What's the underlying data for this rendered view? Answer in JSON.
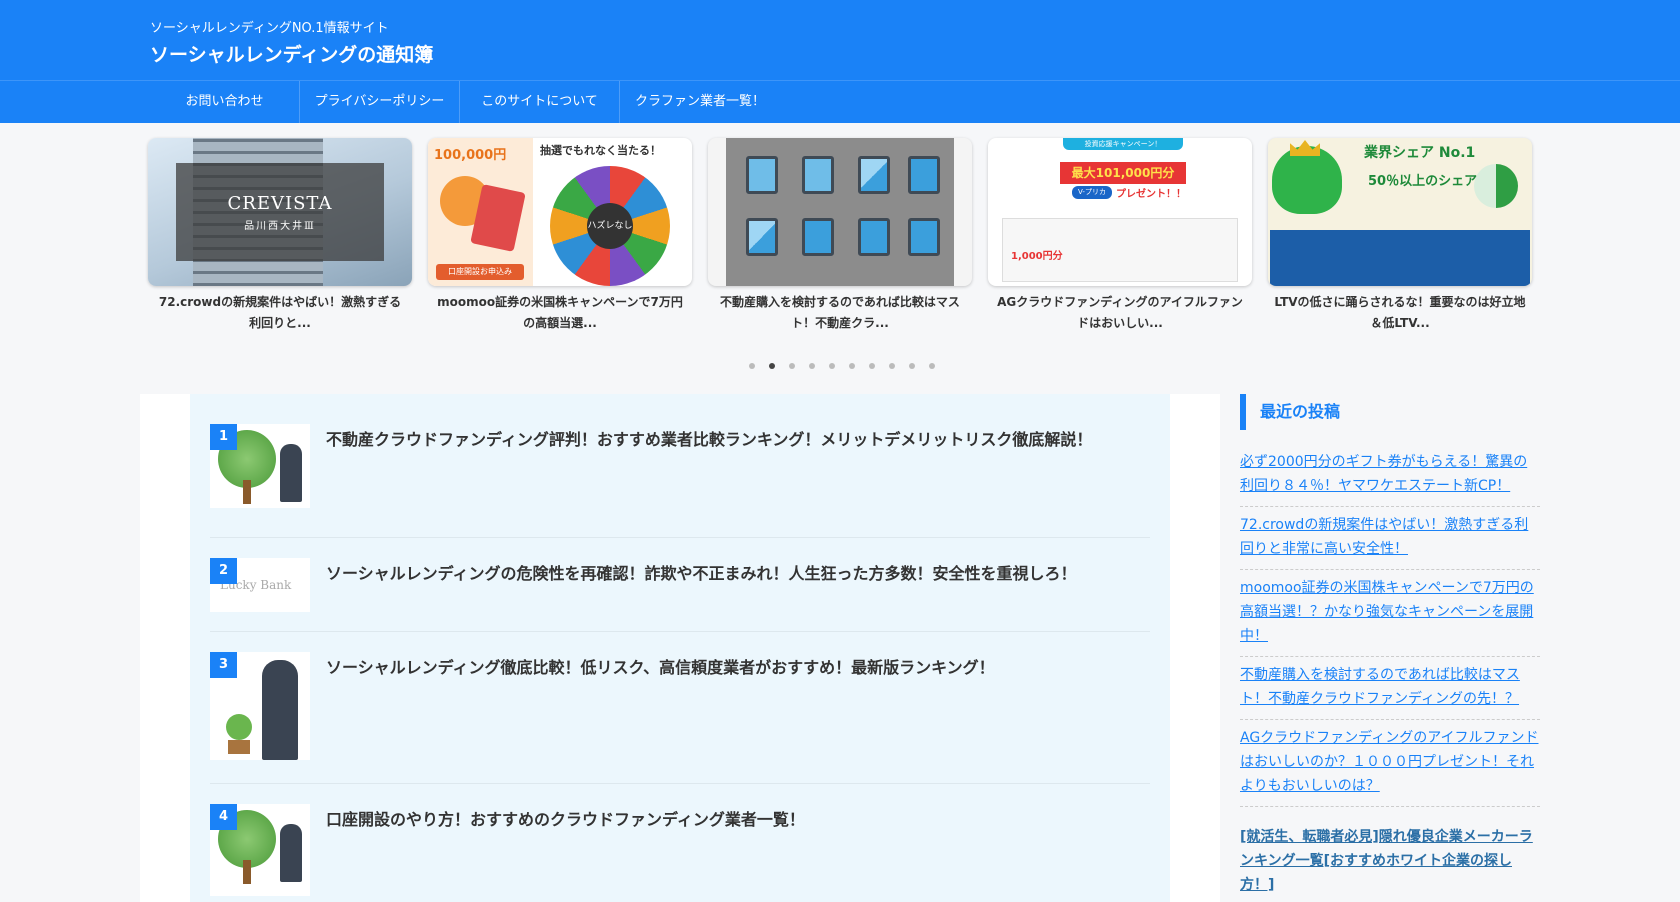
{
  "header": {
    "tagline": "ソーシャルレンディングNO.1情報サイト",
    "title": "ソーシャルレンディングの通知簿"
  },
  "nav": {
    "items": [
      {
        "label": "お問い合わせ"
      },
      {
        "label": "プライバシーポリシー"
      },
      {
        "label": "このサイトについて"
      },
      {
        "label": "クラファン業者一覧！"
      }
    ]
  },
  "carousel": {
    "cards": [
      {
        "title": "72.crowdの新規案件はやばい！激熱すぎる利回りと...",
        "logo": "CREVISTA",
        "logo_sub": "品川西大井Ⅲ"
      },
      {
        "title": "moomoo証券の米国株キャンペーンで7万円の高額当選...",
        "promo_amount": "100,000円",
        "promo_head": "抽選でもれなく当たる！",
        "wheel_center": "ハズレなし",
        "button": "口座開設お申込み"
      },
      {
        "title": "不動産購入を検討するのであれば比較はマスト！不動産クラ..."
      },
      {
        "title": "AGクラウドファンディングのアイフルファンドはおいしい...",
        "banner_tag": "投資応援キャンペーン！",
        "amount": "最大101,000円分",
        "vpreca": "V-プリカ",
        "present": "プレゼント！！",
        "sub_amount": "1,000円分"
      },
      {
        "title": "LTVの低さに踊らされるな！重要なのは好立地＆低LTV...",
        "share_title": "業界シェア No.1",
        "share_text": "50％以上のシェア"
      }
    ],
    "dots": 10,
    "active_dot": 1
  },
  "ranking": {
    "items": [
      {
        "rank": "1",
        "title": "不動産クラウドファンディング評判！おすすめ業者比較ランキング！メリットデメリットリスク徹底解説！"
      },
      {
        "rank": "2",
        "title": "ソーシャルレンディングの危険性を再確認！詐欺や不正まみれ！人生狂った方多数！安全性を重視しろ！",
        "thumb_text": "Lucky Bank"
      },
      {
        "rank": "3",
        "title": "ソーシャルレンディング徹底比較！低リスク、高信頼度業者がおすすめ！最新版ランキング！"
      },
      {
        "rank": "4",
        "title": "口座開設のやり方！おすすめのクラウドファンディング業者一覧！"
      }
    ]
  },
  "sidebar": {
    "heading": "最近の投稿",
    "posts": [
      {
        "title": "必ず2000円分のギフト券がもらえる！驚異の利回り８４％！ヤマワケエステート新CP！"
      },
      {
        "title": "72.crowdの新規案件はやばい！激熱すぎる利回りと非常に高い安全性！"
      },
      {
        "title": "moomoo証券の米国株キャンペーンで7万円の高額当選！？かなり強気なキャンペーンを展開中！"
      },
      {
        "title": "不動産購入を検討するのであれば比較はマスト！不動産クラウドファンディングの先！？"
      },
      {
        "title": "AGクラウドファンディングのアイフルファンドはおいしいのか？１０００円プレゼント！それよりもおいしいのは？"
      },
      {
        "title": "[就活生、転職者必見]隠れ優良企業メーカーランキング一覧[おすすめホワイト企業の探し方！]"
      }
    ]
  },
  "colors": {
    "brand": "#1a82f7",
    "panel": "#ecf7fd",
    "page_bg": "#f6f7f9"
  }
}
